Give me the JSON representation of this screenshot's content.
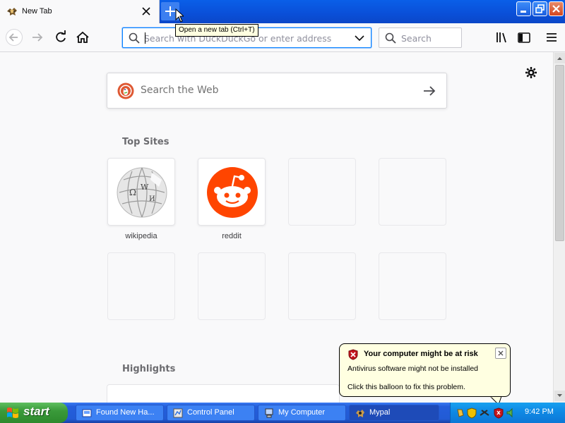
{
  "browser": {
    "tab_title": "New Tab",
    "tooltip": "Open a new tab (Ctrl+T)",
    "url_placeholder": "Search with DuckDuckGo or enter address",
    "search_placeholder": "Search"
  },
  "newtab": {
    "web_search_placeholder": "Search the Web",
    "top_sites_title": "Top Sites",
    "top_sites": [
      {
        "label": "wikipedia"
      },
      {
        "label": "reddit"
      }
    ],
    "highlights_title": "Highlights"
  },
  "balloon": {
    "title": "Your computer might be at risk",
    "line1": "Antivirus software might not be installed",
    "line2": "Click this balloon to fix this problem."
  },
  "taskbar": {
    "start_label": "start",
    "tasks": [
      {
        "label": "Found New Ha..."
      },
      {
        "label": "Control Panel"
      },
      {
        "label": "My Computer"
      },
      {
        "label": "Mypal"
      }
    ],
    "clock": "9:42 PM"
  },
  "colors": {
    "accent": "#0a84ff",
    "reddit": "#ff4500",
    "duckduckgo": "#de5833",
    "xp_blue": "#245edb",
    "xp_green": "#3a9a3a"
  }
}
